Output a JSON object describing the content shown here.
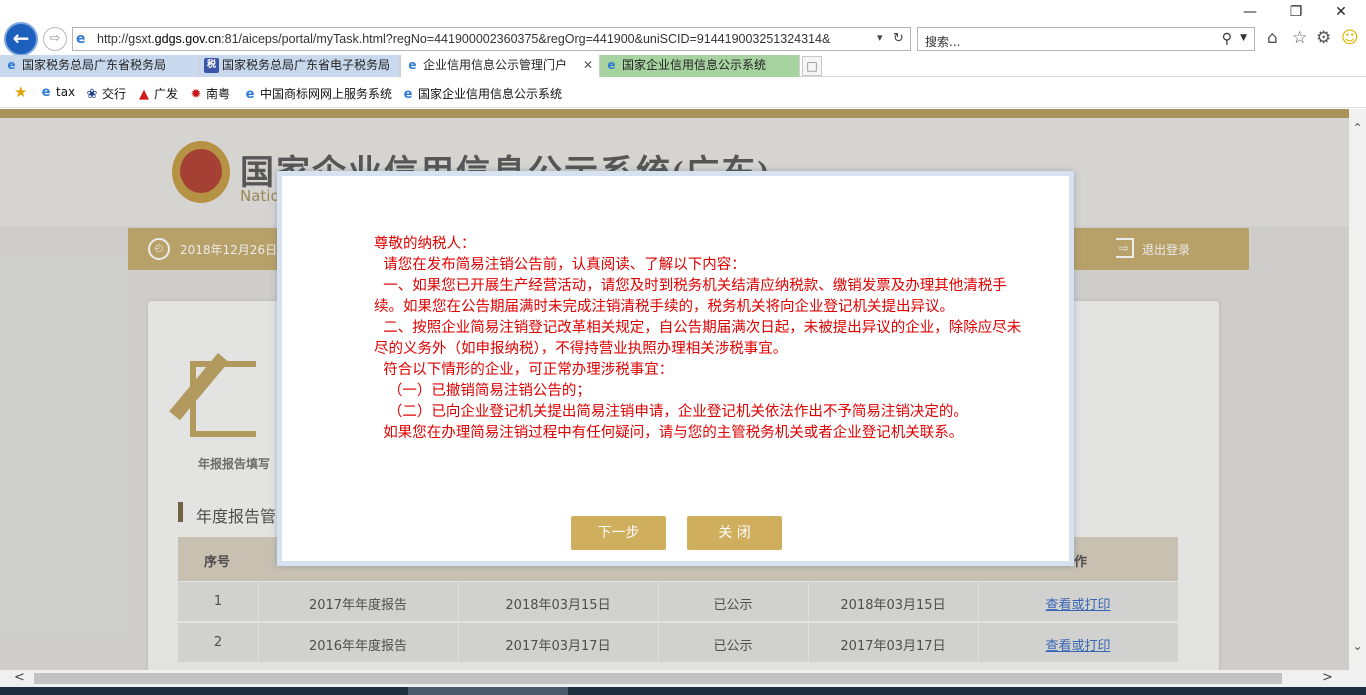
{
  "browser": {
    "url_prefix": "http://gsxt.",
    "url_domain": "gdgs.gov.cn",
    "url_rest": ":81/aiceps/portal/myTask.html?regNo=441900002360375&regOrg=441900&uniSCID=914419003251324314&",
    "search_placeholder": "搜索...",
    "tabs": [
      {
        "label": "国家税务总局广东省税务局"
      },
      {
        "label": "国家税务总局广东省电子税务局"
      },
      {
        "label": "企业信用信息公示管理门户"
      },
      {
        "label": "国家企业信用信息公示系统"
      }
    ],
    "favorites": [
      {
        "label": "tax"
      },
      {
        "label": "交行"
      },
      {
        "label": "广发"
      },
      {
        "label": "南粤"
      },
      {
        "label": "中国商标网网上服务系统"
      },
      {
        "label": "国家企业信用信息公示系统"
      }
    ]
  },
  "site": {
    "title": "国家企业信用信息公示系统(广东)",
    "subtitle": "Natio",
    "date": "2018年12月26日",
    "logout": "退出登录",
    "report_icon_label": "年报报告填写",
    "section_title": "年度报告管"
  },
  "table": {
    "headers": {
      "no": "序号",
      "action": "作"
    },
    "rows": [
      {
        "no": "1",
        "name": "2017年年度报告",
        "submit_date": "2018年03月15日",
        "status": "已公示",
        "publish_date": "2018年03月15日",
        "action": "查看或打印"
      },
      {
        "no": "2",
        "name": "2016年年度报告",
        "submit_date": "2017年03月17日",
        "status": "已公示",
        "publish_date": "2017年03月17日",
        "action": "查看或打印"
      }
    ]
  },
  "modal": {
    "lines": [
      "尊敬的纳税人：",
      "  请您在发布简易注销公告前，认真阅读、了解以下内容：",
      "  一、如果您已开展生产经营活动，请您及时到税务机关结清应纳税款、缴销发票及办理其他清税手续。如果您在公告期届满时未完成注销清税手续的，税务机关将向企业登记机关提出异议。",
      "  二、按照企业简易注销登记改革相关规定，自公告期届满次日起，未被提出异议的企业，除除应尽未尽的义务外（如申报纳税），不得持营业执照办理相关涉税事宜。",
      "  符合以下情形的企业，可正常办理涉税事宜：",
      "   （一）已撤销简易注销公告的；",
      "   （二）已向企业登记机关提出简易注销申请，企业登记机关依法作出不予简易注销决定的。",
      "  如果您在办理简易注销过程中有任何疑问，请与您的主管税务机关或者企业登记机关联系。"
    ],
    "next_button": "下一步",
    "close_button": "关 闭"
  }
}
